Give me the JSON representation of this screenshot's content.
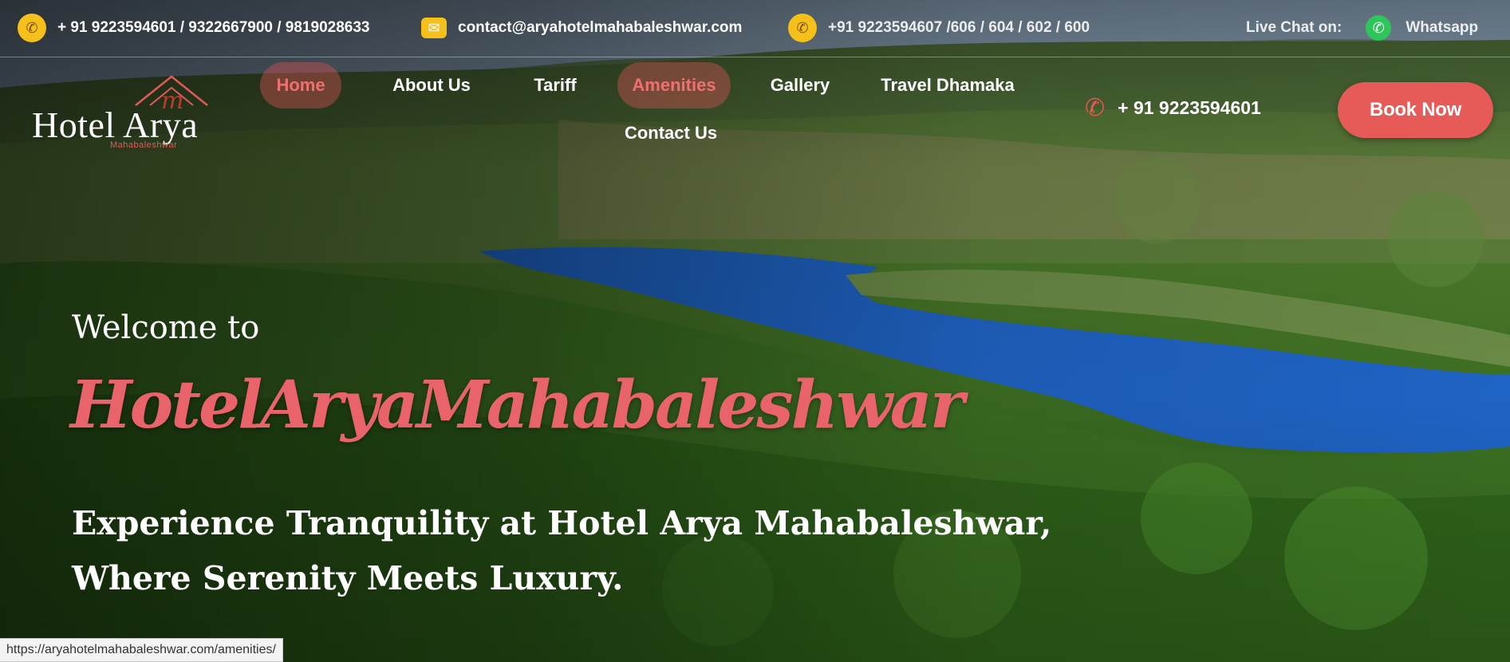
{
  "topbar": {
    "phones": "+ 91 9223594601 / 9322667900 / 9819028633",
    "email": "contact@aryahotelmahabaleshwar.com",
    "whatsapp_numbers": "+91 9223594607 /606 / 604 / 602 / 600",
    "live_chat_label": "Live Chat on:",
    "whatsapp_label": "Whatsapp"
  },
  "logo": {
    "title": "Hotel Arya",
    "subtitle": "Mahabaleshwar"
  },
  "nav": {
    "items": [
      {
        "label": "Home",
        "active": true
      },
      {
        "label": "About Us",
        "active": false
      },
      {
        "label": "Tariff",
        "active": false
      },
      {
        "label": "Amenities",
        "active": true
      },
      {
        "label": "Gallery",
        "active": false
      },
      {
        "label": "Travel Dhamaka",
        "active": false
      },
      {
        "label": "Contact Us",
        "active": false
      }
    ]
  },
  "header": {
    "phone": "+ 91 9223594601",
    "book_label": "Book Now"
  },
  "hero": {
    "welcome": "Welcome to",
    "script_title": "HotelAryaMahabaleshwar",
    "tagline_line1": "Experience Tranquility at Hotel Arya Mahabaleshwar,",
    "tagline_line2": "Where Serenity Meets Luxury."
  },
  "status": {
    "hover_url": "https://aryahotelmahabaleshwar.com/amenities/"
  },
  "colors": {
    "accent": "#e65a57",
    "title_pink": "#e8636a",
    "icon_yellow": "#f5c01a",
    "whatsapp_green": "#2ec55a",
    "lake_blue": "#1f63c4"
  },
  "icons": {
    "phone": "phone-icon",
    "mail": "mail-icon",
    "whatsapp": "whatsapp-icon",
    "call": "call-icon"
  }
}
